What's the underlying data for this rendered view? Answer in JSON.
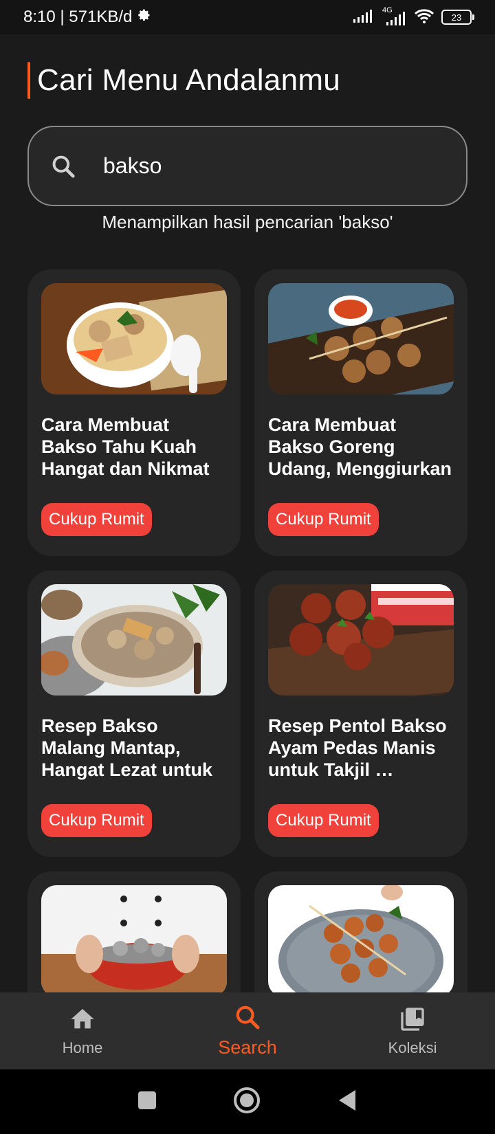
{
  "status_bar": {
    "time_data": "8:10 | 571KB/d",
    "network_label": "4G",
    "battery": "23"
  },
  "header": {
    "title": "Cari Menu Andalanmu"
  },
  "search": {
    "value": "bakso",
    "result_text": "Menampilkan hasil pencarian 'bakso'"
  },
  "recipes": [
    {
      "title": "Cara Membuat Bakso Tahu Kuah Hangat dan Nikmat",
      "difficulty": "Cukup Rumit"
    },
    {
      "title": "Cara Membuat Bakso Goreng Udang, Menggiurkan untuk…",
      "difficulty": "Cukup Rumit"
    },
    {
      "title": "Resep Bakso Malang Mantap, Hangat Lezat untuk Menu …",
      "difficulty": "Cukup Rumit"
    },
    {
      "title": "Resep Pentol Bakso Ayam Pedas Manis untuk Takjil …",
      "difficulty": "Cukup Rumit"
    },
    {
      "title": "",
      "difficulty": ""
    },
    {
      "title": "",
      "difficulty": ""
    }
  ],
  "bottom_nav": {
    "home": "Home",
    "search": "Search",
    "collection": "Koleksi"
  },
  "colors": {
    "accent": "#ff5a1f",
    "badge": "#f0423a",
    "background": "#1b1b1b",
    "card": "#262626"
  }
}
